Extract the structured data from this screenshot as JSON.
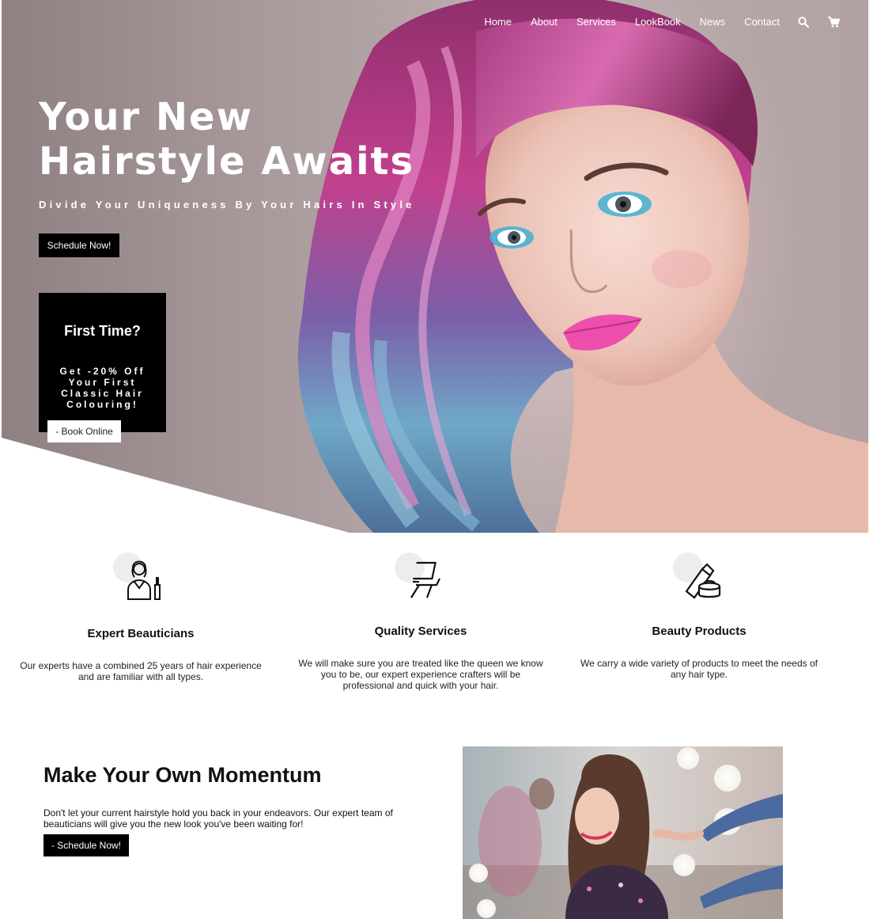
{
  "nav": {
    "items": [
      "Home",
      "About",
      "Services",
      "LookBook",
      "News",
      "Contact"
    ]
  },
  "hero": {
    "title_line1": "Your New",
    "title_line2": "Hairstyle Awaits",
    "subtitle": "Divide Your Uniqueness By Your Hairs In Style",
    "cta_label": "Schedule Now!"
  },
  "promo": {
    "title": "First Time?",
    "text": "Get -20% Off Your First Classic Hair Colouring!",
    "button_label": "- Book Online"
  },
  "features": [
    {
      "icon": "beautician-icon",
      "title": "Expert Beauticians",
      "description": "Our experts have a combined 25 years of hair experience and are familiar with all types."
    },
    {
      "icon": "salon-chair-icon",
      "title": "Quality Services",
      "description": "We will make sure you are treated like the queen we know you to be, our expert experience crafters will be professional and quick with your hair."
    },
    {
      "icon": "beauty-products-icon",
      "title": "Beauty Products",
      "description": "We carry a wide variety of products to meet the needs of any hair type."
    }
  ],
  "momentum": {
    "title": "Make Your Own Momentum",
    "text": "Don't let your current hairstyle hold you back in your endeavors. Our expert team of beauticians will give you the new look you've been waiting for!",
    "button_label": "- Schedule Now!"
  },
  "icons": {
    "search": "search-icon",
    "cart": "cart-icon"
  },
  "colors": {
    "button_bg": "#000000",
    "hero_bg": "#b2a2a4",
    "hair_pink": "#c2408e",
    "hair_blue": "#6fa8c8"
  }
}
